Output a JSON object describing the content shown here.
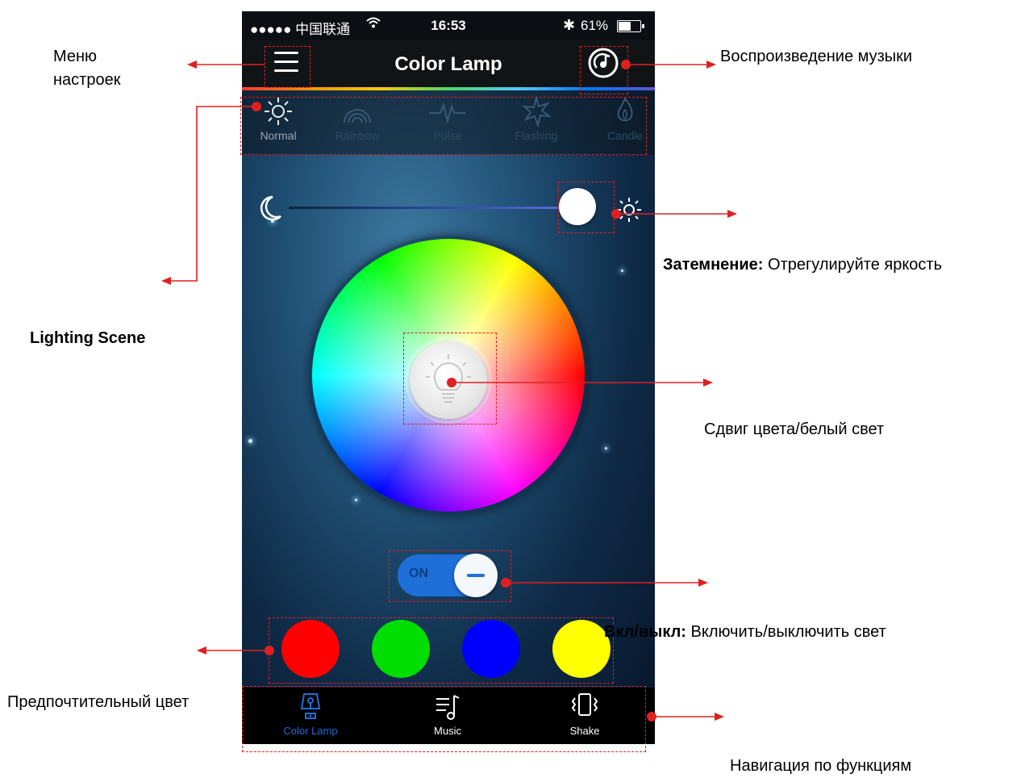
{
  "status_bar": {
    "carrier": "●●●●● 中国联通 ",
    "time": "16:53",
    "battery_percent": "61%",
    "battery_level": 0.61
  },
  "header": {
    "title": "Color Lamp",
    "menu_icon": "hamburger-icon",
    "music_icon": "music-disc-icon"
  },
  "scenes": [
    {
      "label": "Normal",
      "icon": "sun-icon",
      "active": true
    },
    {
      "label": "Rainbow",
      "icon": "rainbow-icon",
      "active": false
    },
    {
      "label": "Pulse",
      "icon": "pulse-icon",
      "active": false
    },
    {
      "label": "Flashing",
      "icon": "flash-icon",
      "active": false
    },
    {
      "label": "Candle",
      "icon": "flame-icon",
      "active": false
    }
  ],
  "brightness": {
    "level": 0.95,
    "min_icon": "moon-icon",
    "max_icon": "sun-icon"
  },
  "power": {
    "label": "ON",
    "state": true
  },
  "swatches": [
    "#ff0000",
    "#00dd00",
    "#0000ff",
    "#ffff00"
  ],
  "tabs": [
    {
      "label": "Color Lamp",
      "icon": "lamp-icon",
      "active": true
    },
    {
      "label": "Music",
      "icon": "music-list-icon",
      "active": false
    },
    {
      "label": "Shake",
      "icon": "shake-phone-icon",
      "active": false
    }
  ],
  "colors": {
    "accent": "#1e6fd8",
    "annotation": "#e02020"
  },
  "annotations": {
    "settings_menu": "Меню\nнастроек",
    "music_playback": "Воспроизведение музыки",
    "lighting_scene": "Lighting Scene",
    "dimming_bold": "Затемнение:",
    "dimming_text": " Отрегулируйте яркость",
    "color_shift": "Сдвиг цвета/белый свет",
    "onoff_bold": "Вкл/выкл:",
    "onoff_text": " Включить/выключить свет",
    "preferred_color": "Предпочтительный цвет",
    "function_navigation": "Навигация по функциям"
  }
}
